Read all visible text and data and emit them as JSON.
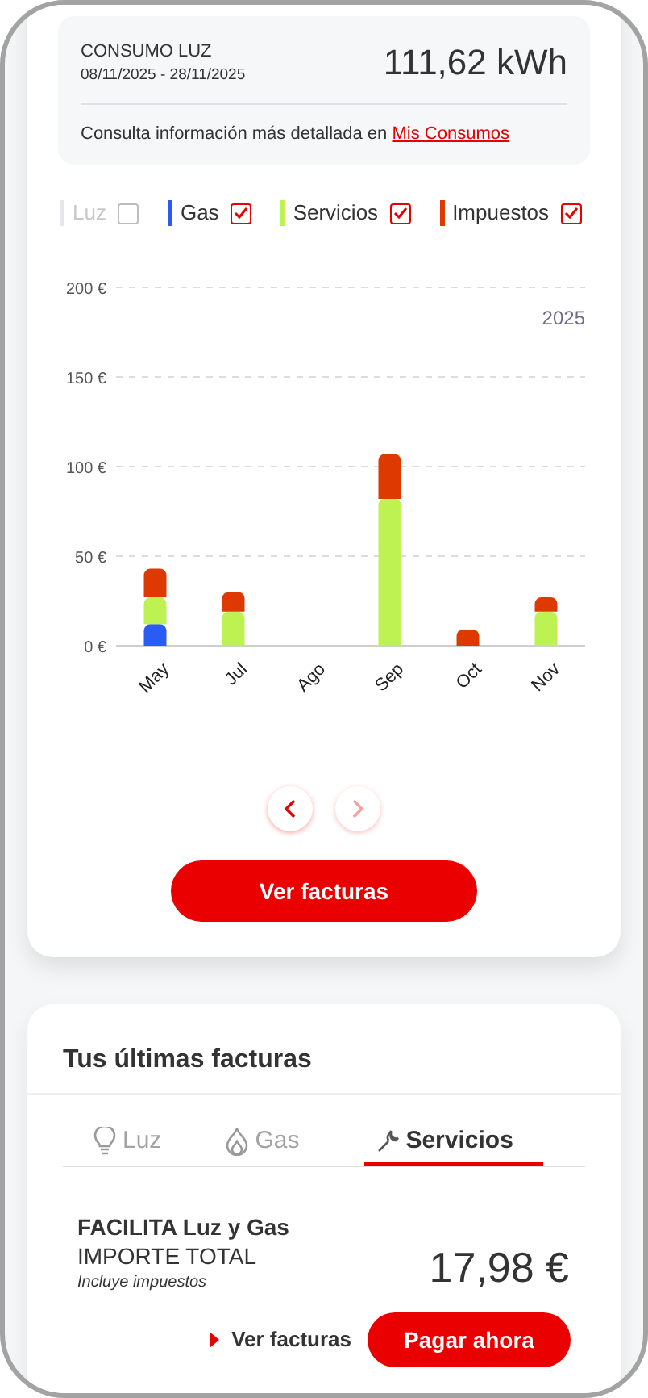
{
  "consumption": {
    "title": "CONSUMO LUZ",
    "period": "08/11/2025 - 28/11/2025",
    "value": "111,62 kWh",
    "note": "Consulta información más detallada en",
    "link": "Mis Consumos"
  },
  "legend": [
    {
      "checked": false
    },
    {
      "checked": true
    },
    {
      "checked": true
    },
    {
      "checked": true
    }
  ],
  "chart_data": {
    "type": "bar",
    "stacked": true,
    "grid": true,
    "categories": [
      "May",
      "Jul",
      "Ago",
      "Sep",
      "Oct",
      "Nov"
    ],
    "series": [
      {
        "name": "Luz",
        "color": "#e5e7eb",
        "values": [
          null,
          null,
          null,
          null,
          null,
          null
        ]
      },
      {
        "name": "Gas",
        "color": "#2b5bf5",
        "values": [
          12,
          0,
          0,
          0,
          0,
          0
        ]
      },
      {
        "name": "Servicios",
        "color": "#bef252",
        "values": [
          15,
          19,
          0,
          82,
          0,
          19
        ]
      },
      {
        "name": "Impuestos",
        "color": "#de3a00",
        "values": [
          16,
          11,
          0,
          25,
          9,
          8
        ]
      }
    ],
    "ylim": [
      0,
      200
    ],
    "yticks": [
      {
        "value": 0,
        "label": "0 €"
      },
      {
        "value": 50,
        "label": "50 €"
      },
      {
        "value": 100,
        "label": "100 €"
      },
      {
        "value": 150,
        "label": "150 €"
      },
      {
        "value": 200,
        "label": "200 €"
      }
    ],
    "annotations": [
      "2025"
    ]
  },
  "pager": {
    "prev_disabled": false,
    "next_disabled": true
  },
  "chart_button": "Ver facturas",
  "invoices": {
    "title": "Tus últimas facturas",
    "tabs": [
      {
        "label": "Luz",
        "kind": "bulb",
        "selected": false
      },
      {
        "label": "Gas",
        "kind": "flame",
        "selected": false
      },
      {
        "label": "Servicios",
        "kind": "wrench",
        "selected": true
      }
    ],
    "product": "FACILITA Luz y Gas",
    "amount_label": "IMPORTE TOTAL",
    "tax_note": "Incluye impuestos",
    "amount": "17,98 €",
    "link": "Ver facturas",
    "pay_button": "Pagar ahora"
  }
}
